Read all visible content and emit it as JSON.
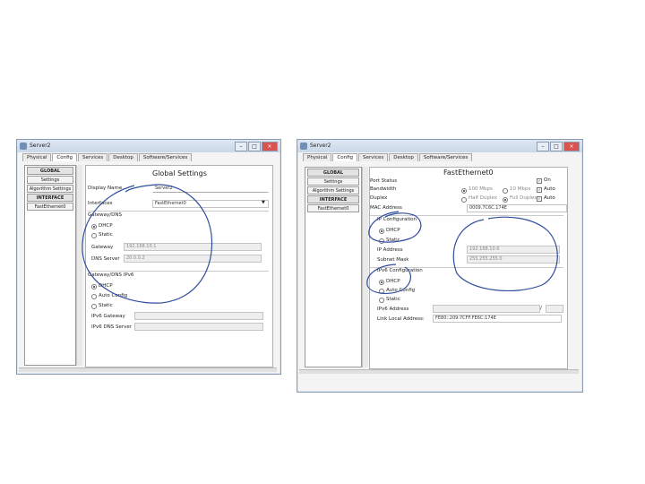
{
  "left_window": {
    "title": "Server2",
    "tabs": [
      "Physical",
      "Config",
      "Services",
      "Desktop",
      "Software/Services"
    ],
    "sidebar": [
      "GLOBAL",
      "Settings",
      "Algorithm Settings",
      "INTERFACE",
      "FastEthernet0"
    ],
    "heading": "Global Settings",
    "display_name_label": "Display Name",
    "display_name_value": "Server2",
    "interfaces_label": "Interfaces",
    "interfaces_value": "FastEthernet0",
    "gateway_dns_heading": "Gateway/DNS",
    "dhcp_label": "DHCP",
    "static_label": "Static",
    "gateway_label": "Gateway",
    "gateway_value": "192.168.10.1",
    "dns_label": "DNS Server",
    "dns_value": "20.0.0.2",
    "ipv6_heading": "Gateway/DNS IPv6",
    "ipv6_dhcp_label": "DHCP",
    "ipv6_auto_label": "Auto Config",
    "ipv6_static_label": "Static",
    "ipv6_gateway_label": "IPv6 Gateway",
    "ipv6_dns_label": "IPv6 DNS Server"
  },
  "right_window": {
    "title": "Server2",
    "tabs": [
      "Physical",
      "Config",
      "Services",
      "Desktop",
      "Software/Services"
    ],
    "sidebar": [
      "GLOBAL",
      "Settings",
      "Algorithm Settings",
      "INTERFACE",
      "FastEthernet0"
    ],
    "heading": "FastEthernet0",
    "port_status_label": "Port Status",
    "on_label": "On",
    "bandwidth_label": "Bandwidth",
    "bw_100_label": "100 Mbps",
    "bw_10_label": "10 Mbps",
    "auto_label": "Auto",
    "duplex_label": "Duplex",
    "half_duplex_label": "Half Duplex",
    "full_duplex_label": "Full Duplex",
    "mac_label": "MAC Address",
    "mac_value": "0009.7C6C.174E",
    "ip_config_heading": "IP Configuration",
    "dhcp_label": "DHCP",
    "static_label": "Static",
    "ip_label": "IP Address",
    "ip_value": "192.168.10.6",
    "mask_label": "Subnet Mask",
    "mask_value": "255.255.255.0",
    "ipv6_config_heading": "IPv6 Configuration",
    "ipv6_dhcp_label": "DHCP",
    "ipv6_auto_label": "Auto Config",
    "ipv6_static_label": "Static",
    "ipv6_address_label": "IPv6 Address",
    "ipv6_address_suffix": "/",
    "link_local_label": "Link Local Address:",
    "link_local_value": "FE80::209:7CFF:FE6C:174E"
  },
  "colors": {
    "annotation": "#2f4e9e",
    "window_border": "#8a9bb0"
  }
}
